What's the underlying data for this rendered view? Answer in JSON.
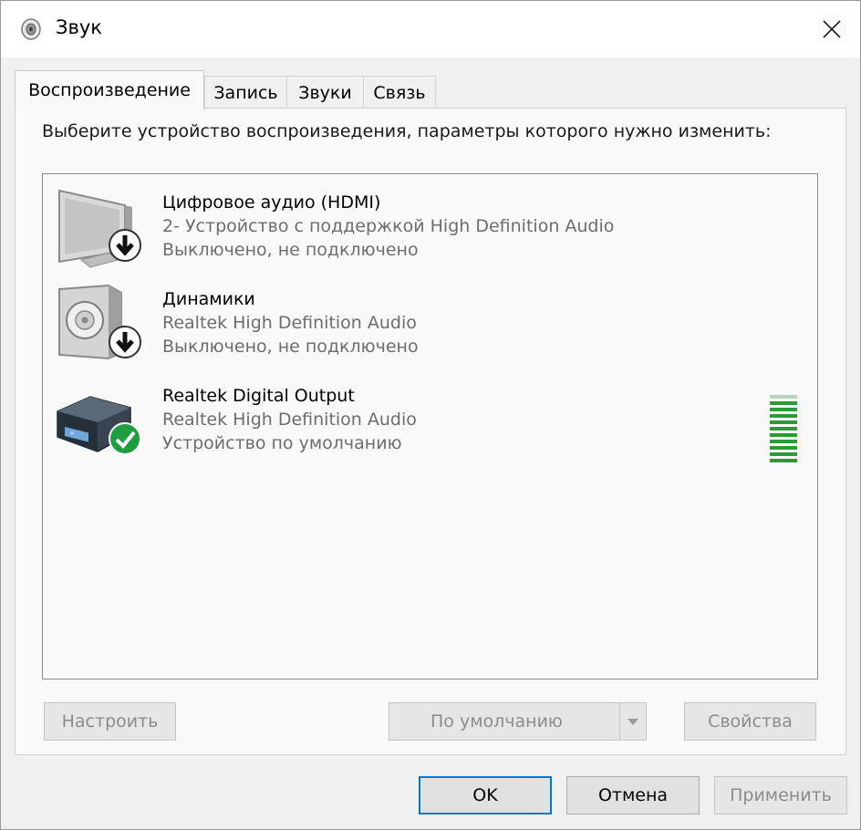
{
  "window": {
    "title": "Звук",
    "icon": "speaker-icon"
  },
  "tabs": [
    {
      "label": "Воспроизведение",
      "active": true
    },
    {
      "label": "Запись",
      "active": false
    },
    {
      "label": "Звуки",
      "active": false
    },
    {
      "label": "Связь",
      "active": false
    }
  ],
  "instruction": "Выберите устройство воспроизведения, параметры которого нужно изменить:",
  "devices": [
    {
      "name": "Цифровое аудио (HDMI)",
      "driver": "2- Устройство с поддержкой High Definition Audio",
      "status": "Выключено, не подключено",
      "icon": "monitor-icon",
      "badge": "disconnected-arrow-icon"
    },
    {
      "name": "Динамики",
      "driver": "Realtek High Definition Audio",
      "status": "Выключено, не подключено",
      "icon": "speaker-box-icon",
      "badge": "disconnected-arrow-icon"
    },
    {
      "name": "Realtek Digital Output",
      "driver": "Realtek High Definition Audio",
      "status": "Устройство по умолчанию",
      "icon": "audio-receiver-icon",
      "badge": "default-check-icon",
      "level_meter": {
        "active_bars": 10,
        "total_bars": 11,
        "color": "#2e9a36"
      }
    }
  ],
  "panel_buttons": {
    "configure": "Настроить",
    "set_default": "По умолчанию",
    "properties": "Свойства"
  },
  "dialog_buttons": {
    "ok": "OK",
    "cancel": "Отмена",
    "apply": "Применить"
  },
  "colors": {
    "accent": "#0078d7",
    "level_green": "#2e9a36",
    "check_green": "#1e9e3e"
  }
}
